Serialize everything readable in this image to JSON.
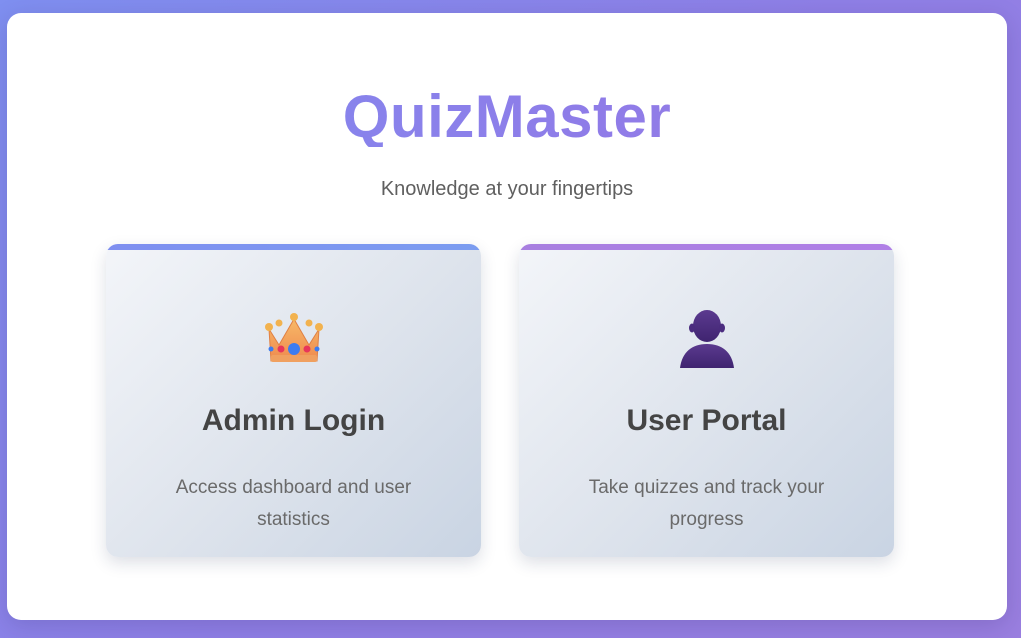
{
  "app": {
    "title": "QuizMaster",
    "tagline": "Knowledge at your fingertips"
  },
  "cards": [
    {
      "title": "Admin Login",
      "description": "Access dashboard and user statistics",
      "icon": "crown-icon",
      "accent": "#7f8ff0"
    },
    {
      "title": "User Portal",
      "description": "Take quizzes and track your progress",
      "icon": "user-silhouette-icon",
      "accent": "#a87fe0"
    }
  ],
  "colors": {
    "background_start": "#7f8ff0",
    "background_end": "#9a7fe0",
    "title_gradient_start": "#7f8cf0",
    "title_gradient_end": "#9b7de0"
  }
}
